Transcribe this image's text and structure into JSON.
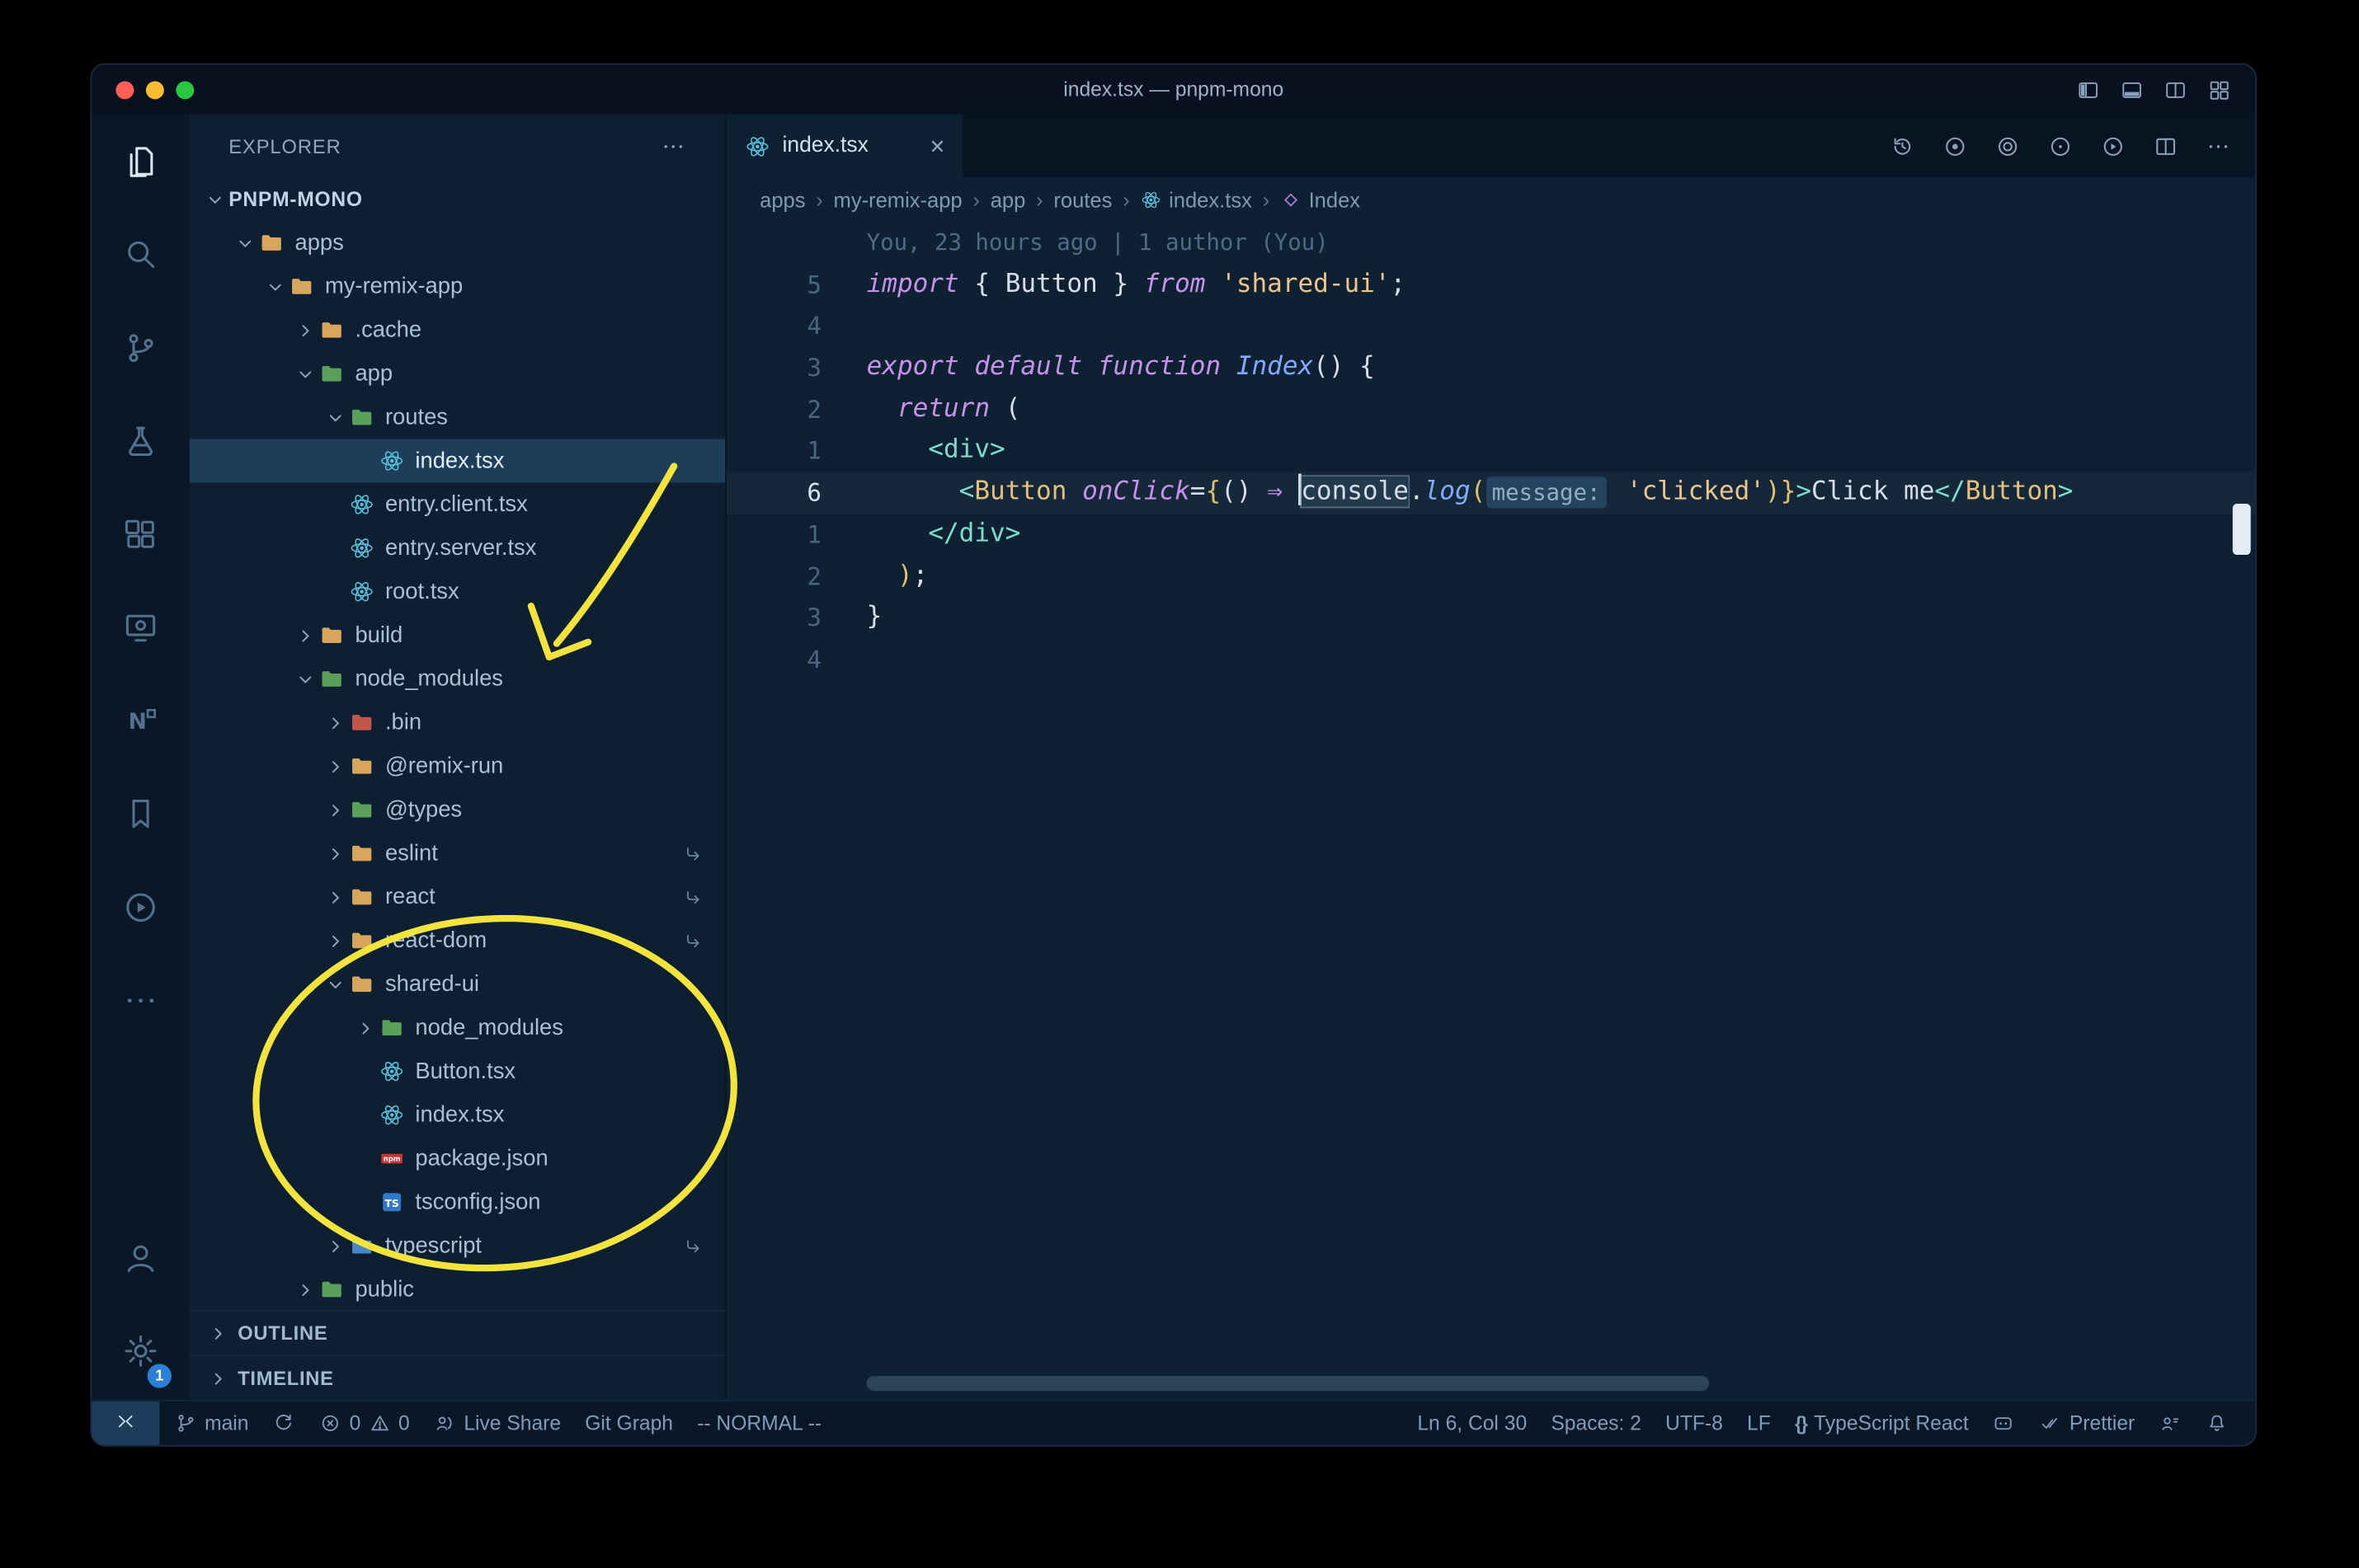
{
  "window": {
    "title": "index.tsx — pnpm-mono"
  },
  "titlebar": {
    "layout_icons": [
      {
        "name": "layout-sidebar",
        "icon": "layout-sidebar"
      },
      {
        "name": "layout-panel",
        "icon": "layout-panel"
      },
      {
        "name": "layout-split",
        "icon": "layout-split"
      },
      {
        "name": "layout-grid",
        "icon": "layout-grid"
      }
    ]
  },
  "activity_bar": {
    "top": [
      {
        "name": "explorer",
        "icon": "files",
        "active": true
      },
      {
        "name": "search",
        "icon": "search",
        "active": false
      },
      {
        "name": "source-control",
        "icon": "scm",
        "active": false
      },
      {
        "name": "run-and-debug",
        "icon": "debug",
        "active": false
      },
      {
        "name": "extensions",
        "icon": "extensions",
        "active": false
      },
      {
        "name": "remote-explorer",
        "icon": "remote-explorer",
        "active": false
      },
      {
        "name": "nx-console",
        "icon": "nx",
        "active": false
      },
      {
        "name": "bookmarks",
        "icon": "bookmarks",
        "active": false
      },
      {
        "name": "live-server",
        "icon": "run-circle",
        "active": false
      },
      {
        "name": "more-views",
        "icon": "more-h",
        "active": false
      }
    ],
    "bottom": [
      {
        "name": "account",
        "icon": "account"
      },
      {
        "name": "settings",
        "icon": "gear",
        "badge": "1"
      }
    ]
  },
  "sidebar": {
    "header": "EXPLORER",
    "sections": {
      "outline": "OUTLINE",
      "timeline": "TIMELINE"
    },
    "tree": [
      {
        "label": "PNPM-MONO",
        "level": 0,
        "chevron": "down",
        "root": true
      },
      {
        "label": "apps",
        "level": 1,
        "chevron": "down",
        "icon": "folder-orange"
      },
      {
        "label": "my-remix-app",
        "level": 2,
        "chevron": "down",
        "icon": "folder-orange"
      },
      {
        "label": ".cache",
        "level": 3,
        "chevron": "right",
        "icon": "folder-orange"
      },
      {
        "label": "app",
        "level": 3,
        "chevron": "down",
        "icon": "folder-green"
      },
      {
        "label": "routes",
        "level": 4,
        "chevron": "down",
        "icon": "folder-green"
      },
      {
        "label": "index.tsx",
        "level": 5,
        "icon": "react",
        "selected": true
      },
      {
        "label": "entry.client.tsx",
        "level": 4,
        "icon": "react"
      },
      {
        "label": "entry.server.tsx",
        "level": 4,
        "icon": "react"
      },
      {
        "label": "root.tsx",
        "level": 4,
        "icon": "react"
      },
      {
        "label": "build",
        "level": 3,
        "chevron": "right",
        "icon": "folder-orange"
      },
      {
        "label": "node_modules",
        "level": 3,
        "chevron": "down",
        "icon": "folder-green"
      },
      {
        "label": ".bin",
        "level": 4,
        "chevron": "right",
        "icon": "folder-red"
      },
      {
        "label": "@remix-run",
        "level": 4,
        "chevron": "right",
        "icon": "folder-orange"
      },
      {
        "label": "@types",
        "level": 4,
        "chevron": "right",
        "icon": "folder-green"
      },
      {
        "label": "eslint",
        "level": 4,
        "chevron": "right",
        "icon": "folder-orange",
        "symlink": true
      },
      {
        "label": "react",
        "level": 4,
        "chevron": "right",
        "icon": "folder-orange",
        "symlink": true
      },
      {
        "label": "react-dom",
        "level": 4,
        "chevron": "right",
        "icon": "folder-orange",
        "symlink": true
      },
      {
        "label": "shared-ui",
        "level": 4,
        "chevron": "down",
        "icon": "folder-orange"
      },
      {
        "label": "node_modules",
        "level": 5,
        "chevron": "right",
        "icon": "folder-green"
      },
      {
        "label": "Button.tsx",
        "level": 5,
        "icon": "react"
      },
      {
        "label": "index.tsx",
        "level": 5,
        "icon": "react"
      },
      {
        "label": "package.json",
        "level": 5,
        "icon": "npm"
      },
      {
        "label": "tsconfig.json",
        "level": 5,
        "icon": "ts"
      },
      {
        "label": "typescript",
        "level": 4,
        "chevron": "right",
        "icon": "folder-blue",
        "symlink": true
      },
      {
        "label": "public",
        "level": 3,
        "chevron": "right",
        "icon": "folder-green"
      }
    ]
  },
  "editor": {
    "tab": {
      "label": "index.tsx",
      "icon": "react"
    },
    "actions": [
      {
        "name": "timeline-history",
        "icon": "history"
      },
      {
        "name": "gitlens",
        "icon": "circle-dot"
      },
      {
        "name": "open-preview",
        "icon": "circle-ring"
      },
      {
        "name": "open-changes",
        "icon": "circle-small"
      },
      {
        "name": "run-code",
        "icon": "play-circle"
      },
      {
        "name": "split-editor",
        "icon": "split"
      },
      {
        "name": "more-actions",
        "icon": "more-h"
      }
    ],
    "breadcrumbs": [
      {
        "label": "apps"
      },
      {
        "label": "my-remix-app"
      },
      {
        "label": "app"
      },
      {
        "label": "routes"
      },
      {
        "label": "index.tsx",
        "icon": "react"
      },
      {
        "label": "Index",
        "icon": "symbol"
      }
    ],
    "blame": "You, 23 hours ago | 1 author (You)",
    "code": [
      {
        "num": "5",
        "tokens": [
          [
            "kw",
            "import"
          ],
          [
            "tx",
            " { "
          ],
          [
            "tx",
            "Button"
          ],
          [
            "tx",
            " } "
          ],
          [
            "kw",
            "from"
          ],
          [
            "tx",
            " "
          ],
          [
            "str",
            "'shared-ui'"
          ],
          [
            "tx",
            ";"
          ]
        ]
      },
      {
        "num": "4",
        "tokens": []
      },
      {
        "num": "3",
        "tokens": [
          [
            "kw",
            "export"
          ],
          [
            "tx",
            " "
          ],
          [
            "kw",
            "default"
          ],
          [
            "tx",
            " "
          ],
          [
            "kw",
            "function"
          ],
          [
            "tx",
            " "
          ],
          [
            "fn",
            "Index"
          ],
          [
            "tx",
            "() {"
          ]
        ]
      },
      {
        "num": "2",
        "tokens": [
          [
            "tx",
            "  "
          ],
          [
            "kw",
            "return"
          ],
          [
            "tx",
            " ("
          ]
        ]
      },
      {
        "num": "1",
        "tokens": [
          [
            "tx",
            "    "
          ],
          [
            "tag",
            "<div>"
          ]
        ]
      },
      {
        "num": "6",
        "current": true,
        "tokens": [
          [
            "tx",
            "      "
          ],
          [
            "tag",
            "<"
          ],
          [
            "comp",
            "Button"
          ],
          [
            "tx",
            " "
          ],
          [
            "attr",
            "onClick"
          ],
          [
            "tx",
            "="
          ],
          [
            "br",
            "{"
          ],
          [
            "tx",
            "() "
          ],
          [
            "op",
            "⇒"
          ],
          [
            "tx",
            " "
          ],
          [
            "cursor",
            ""
          ],
          [
            "occ",
            "console"
          ],
          [
            "tx",
            "."
          ],
          [
            "fn",
            "log"
          ],
          [
            "br",
            "("
          ],
          [
            "inlay",
            "message:"
          ],
          [
            "tx",
            " "
          ],
          [
            "str",
            "'clicked'"
          ],
          [
            "br",
            ")"
          ],
          [
            "br",
            "}"
          ],
          [
            "tag",
            ">"
          ],
          [
            "tx",
            "Click me"
          ],
          [
            "tag",
            "</"
          ],
          [
            "comp",
            "Button"
          ],
          [
            "tag",
            ">"
          ]
        ]
      },
      {
        "num": "1",
        "tokens": [
          [
            "tx",
            "    "
          ],
          [
            "tag",
            "</div>"
          ]
        ]
      },
      {
        "num": "2",
        "tokens": [
          [
            "tx",
            "  "
          ],
          [
            "br",
            ")"
          ],
          [
            "tx",
            ";"
          ]
        ]
      },
      {
        "num": "3",
        "tokens": [
          [
            "tx",
            "}"
          ]
        ]
      },
      {
        "num": "4",
        "tokens": []
      }
    ]
  },
  "status_bar": {
    "left": [
      {
        "name": "remote-indicator",
        "icon": "remote"
      },
      {
        "name": "git-branch",
        "icon": "branch",
        "label": "main"
      },
      {
        "name": "sync-changes",
        "icon": "sync"
      },
      {
        "name": "problems",
        "parts": [
          {
            "icon": "error",
            "label": "0"
          },
          {
            "icon": "warning",
            "label": "0"
          }
        ]
      },
      {
        "name": "live-share",
        "icon": "liveshare",
        "label": "Live Share"
      },
      {
        "name": "git-graph",
        "label": "Git Graph"
      },
      {
        "name": "vim-mode",
        "label": "-- NORMAL --"
      }
    ],
    "right": [
      {
        "name": "cursor-position",
        "label": "Ln 6, Col 30"
      },
      {
        "name": "indentation",
        "label": "Spaces: 2"
      },
      {
        "name": "encoding",
        "label": "UTF-8"
      },
      {
        "name": "eol",
        "label": "LF"
      },
      {
        "name": "language-mode",
        "icon": "braces",
        "label": "TypeScript React"
      },
      {
        "name": "copilot",
        "icon": "copilot"
      },
      {
        "name": "formatter",
        "icon": "check",
        "label": "Prettier"
      },
      {
        "name": "screencast",
        "icon": "feedback"
      },
      {
        "name": "notifications",
        "icon": "bell"
      }
    ]
  },
  "colors": {
    "annotation": "#f2e43c",
    "react": "#58c4dc",
    "folder_orange": "#d7a65c",
    "folder_green": "#5aa05a",
    "folder_red": "#c2564b",
    "folder_blue": "#4688c7",
    "npm_red": "#c53635",
    "ts_blue": "#3178c6",
    "badge": "#2b7fd4",
    "symbol_purple": "#b180d7",
    "traffic_red": "#ff5f57",
    "traffic_yellow": "#febc2e",
    "traffic_green": "#28c840"
  }
}
